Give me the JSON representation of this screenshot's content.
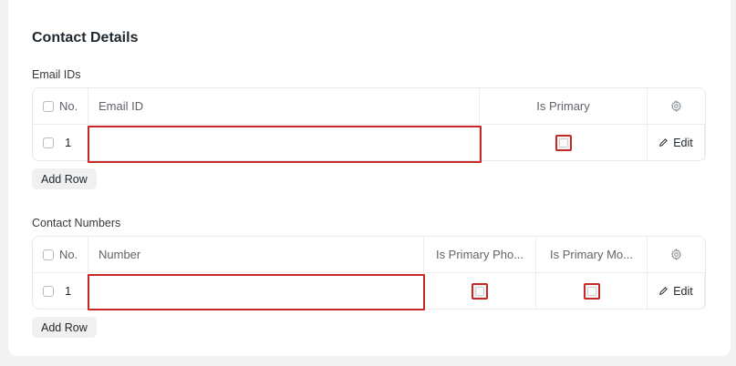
{
  "section": {
    "title": "Contact Details"
  },
  "email_table": {
    "label": "Email IDs",
    "headers": {
      "no": "No.",
      "email": "Email ID",
      "is_primary": "Is Primary"
    },
    "rows": [
      {
        "no": "1",
        "email": "",
        "edit": "Edit"
      }
    ],
    "add_row": "Add Row"
  },
  "phone_table": {
    "label": "Contact Numbers",
    "headers": {
      "no": "No.",
      "number": "Number",
      "is_primary_phone": "Is Primary Pho...",
      "is_primary_mobile": "Is Primary Mo..."
    },
    "rows": [
      {
        "no": "1",
        "number": "",
        "edit": "Edit"
      }
    ],
    "add_row": "Add Row"
  },
  "colors": {
    "highlight": "#c62828",
    "border": "#e8e8e8"
  },
  "icons": {
    "settings": "gear-icon",
    "edit": "pencil-icon"
  }
}
